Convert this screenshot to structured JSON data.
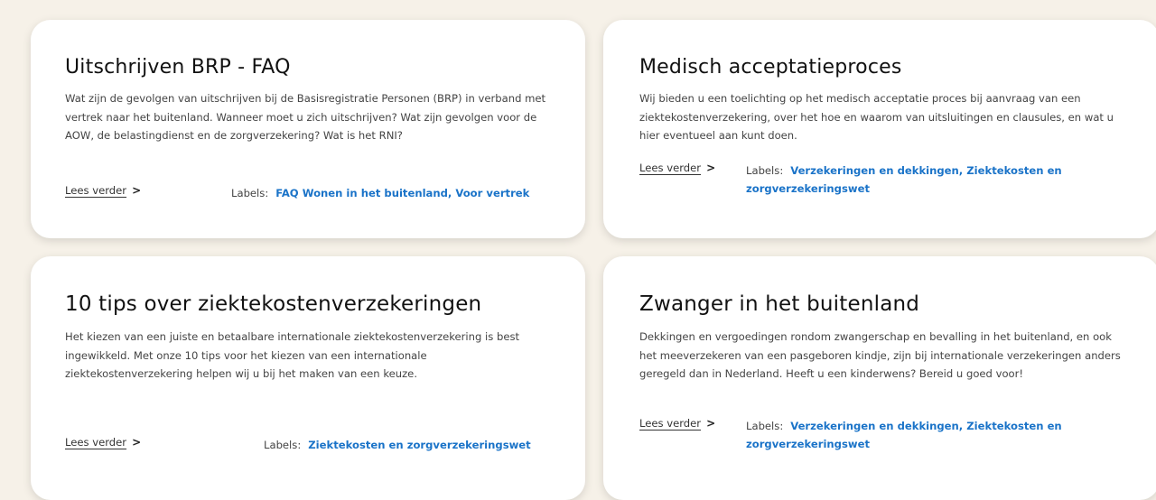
{
  "cards": [
    {
      "title": "Uitschrijven BRP - FAQ",
      "description": "Wat zijn de gevolgen van uitschrijven bij de Basisregistratie Personen (BRP) in verband met vertrek naar het buitenland. Wanneer moet u zich uitschrijven? Wat zijn gevolgen voor de AOW, de belastingdienst en de zorgverzekering? Wat is het RNI?",
      "read_more": "Lees verder",
      "labels_key": "Labels:",
      "labels_value": "FAQ Wonen in het buitenland, Voor vertrek"
    },
    {
      "title": "Medisch acceptatieproces",
      "description": "Wij bieden u een toelichting op het medisch acceptatie proces bij aanvraag van een ziektekostenverzekering, over het hoe en waarom van uitsluitingen en clausules, en wat u hier eventueel aan kunt doen.",
      "read_more": "Lees verder",
      "labels_key": "Labels:",
      "labels_value": "Verzekeringen en dekkingen, Ziektekosten en zorgverzekeringswet"
    },
    {
      "title": "10 tips over ziektekostenverzekeringen",
      "description": "Het kiezen van een juiste en betaalbare internationale ziektekostenverzekering is best ingewikkeld. Met onze 10 tips voor het kiezen van een internationale ziektekostenverzekering helpen wij u bij het maken van een keuze.",
      "read_more": "Lees verder",
      "labels_key": "Labels:",
      "labels_value": "Ziektekosten en zorgverzekeringswet"
    },
    {
      "title": "Zwanger in het buitenland",
      "description": "Dekkingen en vergoedingen rondom zwangerschap en bevalling in het buitenland, en ook het meeverzekeren van een pasgeboren kindje, zijn bij internationale verzekeringen anders geregeld dan in Nederland. Heeft u een kinderwens? Bereid u goed voor!",
      "read_more": "Lees verder",
      "labels_key": "Labels:",
      "labels_value": "Verzekeringen en dekkingen, Ziektekosten en zorgverzekeringswet"
    }
  ],
  "icons": {
    "read_more": "chevron-right-icon"
  }
}
